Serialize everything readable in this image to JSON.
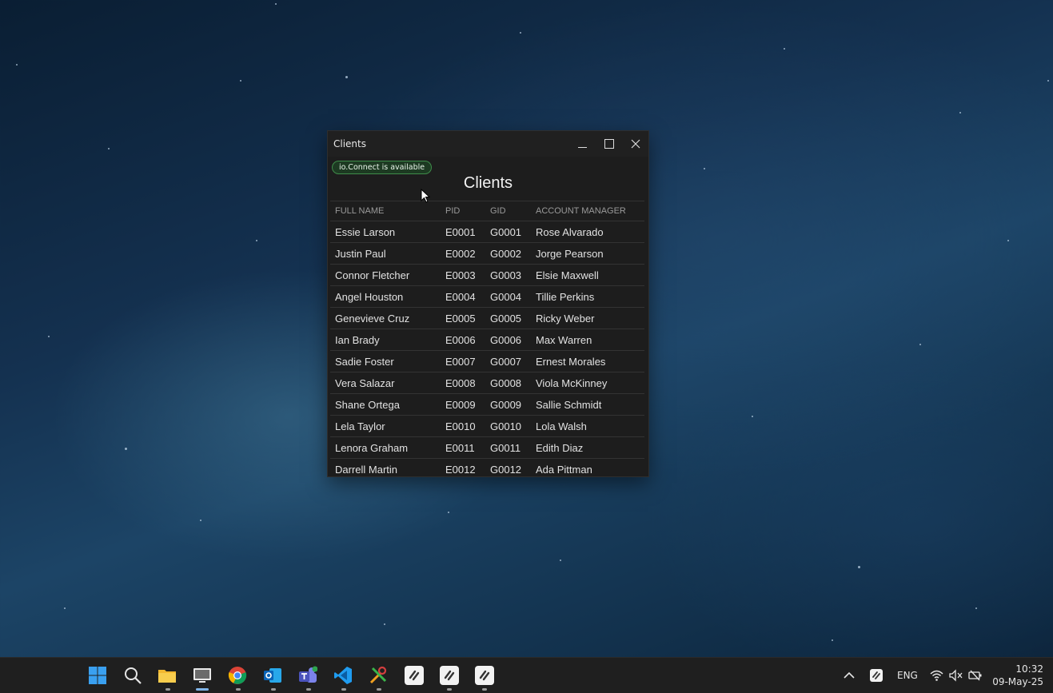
{
  "window": {
    "title": "Clients",
    "connection_badge": "io.Connect is available",
    "heading": "Clients"
  },
  "table": {
    "columns": [
      "FULL NAME",
      "PID",
      "GID",
      "ACCOUNT MANAGER"
    ],
    "rows": [
      [
        "Essie Larson",
        "E0001",
        "G0001",
        "Rose Alvarado"
      ],
      [
        "Justin Paul",
        "E0002",
        "G0002",
        "Jorge Pearson"
      ],
      [
        "Connor Fletcher",
        "E0003",
        "G0003",
        "Elsie Maxwell"
      ],
      [
        "Angel Houston",
        "E0004",
        "G0004",
        "Tillie Perkins"
      ],
      [
        "Genevieve Cruz",
        "E0005",
        "G0005",
        "Ricky Weber"
      ],
      [
        "Ian Brady",
        "E0006",
        "G0006",
        "Max Warren"
      ],
      [
        "Sadie Foster",
        "E0007",
        "G0007",
        "Ernest Morales"
      ],
      [
        "Vera Salazar",
        "E0008",
        "G0008",
        "Viola McKinney"
      ],
      [
        "Shane Ortega",
        "E0009",
        "G0009",
        "Sallie Schmidt"
      ],
      [
        "Lela Taylor",
        "E0010",
        "G0010",
        "Lola Walsh"
      ],
      [
        "Lenora Graham",
        "E0011",
        "G0011",
        "Edith Diaz"
      ],
      [
        "Darrell Martin",
        "E0012",
        "G0012",
        "Ada Pittman"
      ]
    ]
  },
  "taskbar": {
    "apps": [
      "windows-start-icon",
      "search-icon",
      "file-explorer-icon",
      "remote-desktop-icon",
      "chrome-icon",
      "outlook-icon",
      "teams-icon",
      "vscode-icon",
      "tools-icon",
      "io-connect-icon",
      "io-connect-icon",
      "io-connect-icon"
    ],
    "language": "ENG",
    "time": "10:32",
    "date": "09-May-25"
  },
  "colors": {
    "badge_border": "#3f8d4a",
    "window_bg": "#1d1d1d",
    "taskbar_bg": "#1f1f1f",
    "accent": "#7fb4e8"
  }
}
